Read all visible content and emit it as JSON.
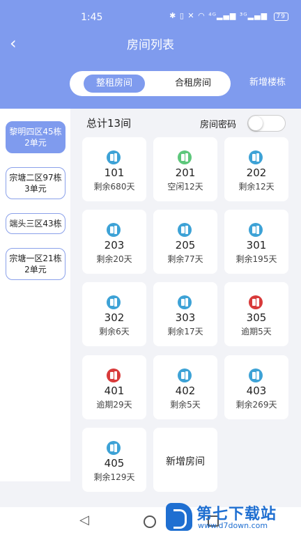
{
  "status_bar": {
    "time": "1:45",
    "icons": "✱ ▯ ✕ ◠ ⁴ᴳ▂▄▆ ³ᴳ▂▄▆",
    "battery": "79"
  },
  "header": {
    "title": "房间列表",
    "back_icon": "‹"
  },
  "tabs": [
    {
      "label": "整租房间",
      "active": true
    },
    {
      "label": "合租房间",
      "active": false
    }
  ],
  "add_building_label": "新增楼栋",
  "buildings": [
    {
      "label": "黎明四区45栋2单元",
      "active": true
    },
    {
      "label": "宗塘二区97栋3单元",
      "active": false
    },
    {
      "label": "端头三区43栋",
      "active": false
    },
    {
      "label": "宗塘一区21栋2单元",
      "active": false
    }
  ],
  "summary": {
    "total_label": "总计13间",
    "password_label": "房间密码",
    "password_enabled": false
  },
  "colors": {
    "accent": "#7f9bee",
    "rented": "#3da2d6",
    "vacant": "#5dc77b",
    "overdue": "#d83a3a"
  },
  "rooms": [
    {
      "number": "101",
      "status": "剩余680天",
      "state": "rented"
    },
    {
      "number": "201",
      "status": "空闲12天",
      "state": "vacant"
    },
    {
      "number": "202",
      "status": "剩余12天",
      "state": "rented"
    },
    {
      "number": "203",
      "status": "剩余20天",
      "state": "rented"
    },
    {
      "number": "205",
      "status": "剩余77天",
      "state": "rented"
    },
    {
      "number": "301",
      "status": "剩余195天",
      "state": "rented"
    },
    {
      "number": "302",
      "status": "剩余6天",
      "state": "rented"
    },
    {
      "number": "303",
      "status": "剩余17天",
      "state": "rented"
    },
    {
      "number": "305",
      "status": "逾期5天",
      "state": "overdue"
    },
    {
      "number": "401",
      "status": "逾期29天",
      "state": "overdue"
    },
    {
      "number": "402",
      "status": "剩余5天",
      "state": "rented"
    },
    {
      "number": "403",
      "status": "剩余269天",
      "state": "rented"
    },
    {
      "number": "405",
      "status": "剩余129天",
      "state": "rented"
    }
  ],
  "add_room_label": "新增房间",
  "nav": {
    "back_icon": "◁"
  },
  "watermark": {
    "title": "第七下载站",
    "url": "www.d7down.com"
  }
}
